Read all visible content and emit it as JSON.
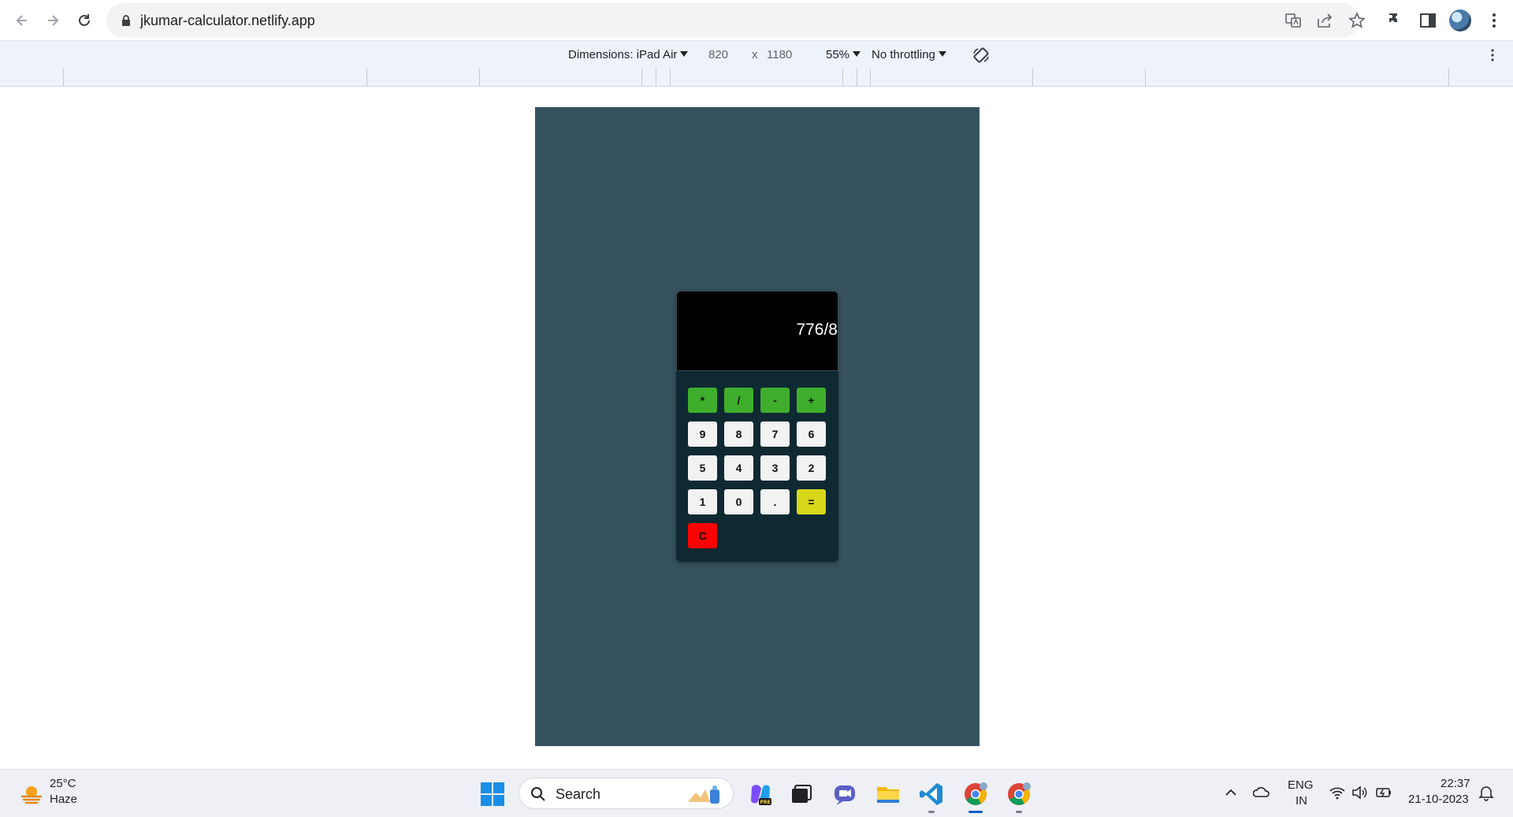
{
  "browser": {
    "url": "jkumar-calculator.netlify.app"
  },
  "device_toolbar": {
    "dimensions_label": "Dimensions: iPad Air",
    "width": "820",
    "times": "x",
    "height": "1180",
    "zoom": "55%",
    "throttling": "No throttling"
  },
  "calculator": {
    "display": "776/8",
    "rows": [
      [
        {
          "label": "*",
          "kind": "op"
        },
        {
          "label": "/",
          "kind": "op"
        },
        {
          "label": "-",
          "kind": "op"
        },
        {
          "label": "+",
          "kind": "op"
        }
      ],
      [
        {
          "label": "9",
          "kind": "num"
        },
        {
          "label": "8",
          "kind": "num"
        },
        {
          "label": "7",
          "kind": "num"
        },
        {
          "label": "6",
          "kind": "num"
        }
      ],
      [
        {
          "label": "5",
          "kind": "num"
        },
        {
          "label": "4",
          "kind": "num"
        },
        {
          "label": "3",
          "kind": "num"
        },
        {
          "label": "2",
          "kind": "num"
        }
      ],
      [
        {
          "label": "1",
          "kind": "num"
        },
        {
          "label": "0",
          "kind": "num"
        },
        {
          "label": ".",
          "kind": "num"
        },
        {
          "label": "=",
          "kind": "eq"
        }
      ],
      [
        {
          "label": "C",
          "kind": "clear"
        }
      ]
    ],
    "colors": {
      "page_bg": "#36525e",
      "calculator_bg": "#0e2932",
      "operator": "#3fae2c",
      "equals": "#d7d81a",
      "clear": "#ff0000",
      "number": "#f2f2f2"
    }
  },
  "taskbar": {
    "weather_temp": "25°C",
    "weather_desc": "Haze",
    "search_label": "Search",
    "language_top": "ENG",
    "language_bottom": "IN",
    "time": "22:37",
    "date": "21-10-2023",
    "apps": [
      "windows-start",
      "copilot-pre",
      "task-view",
      "teams-chat",
      "file-explorer",
      "vs-code",
      "chrome",
      "chrome-profile"
    ]
  }
}
